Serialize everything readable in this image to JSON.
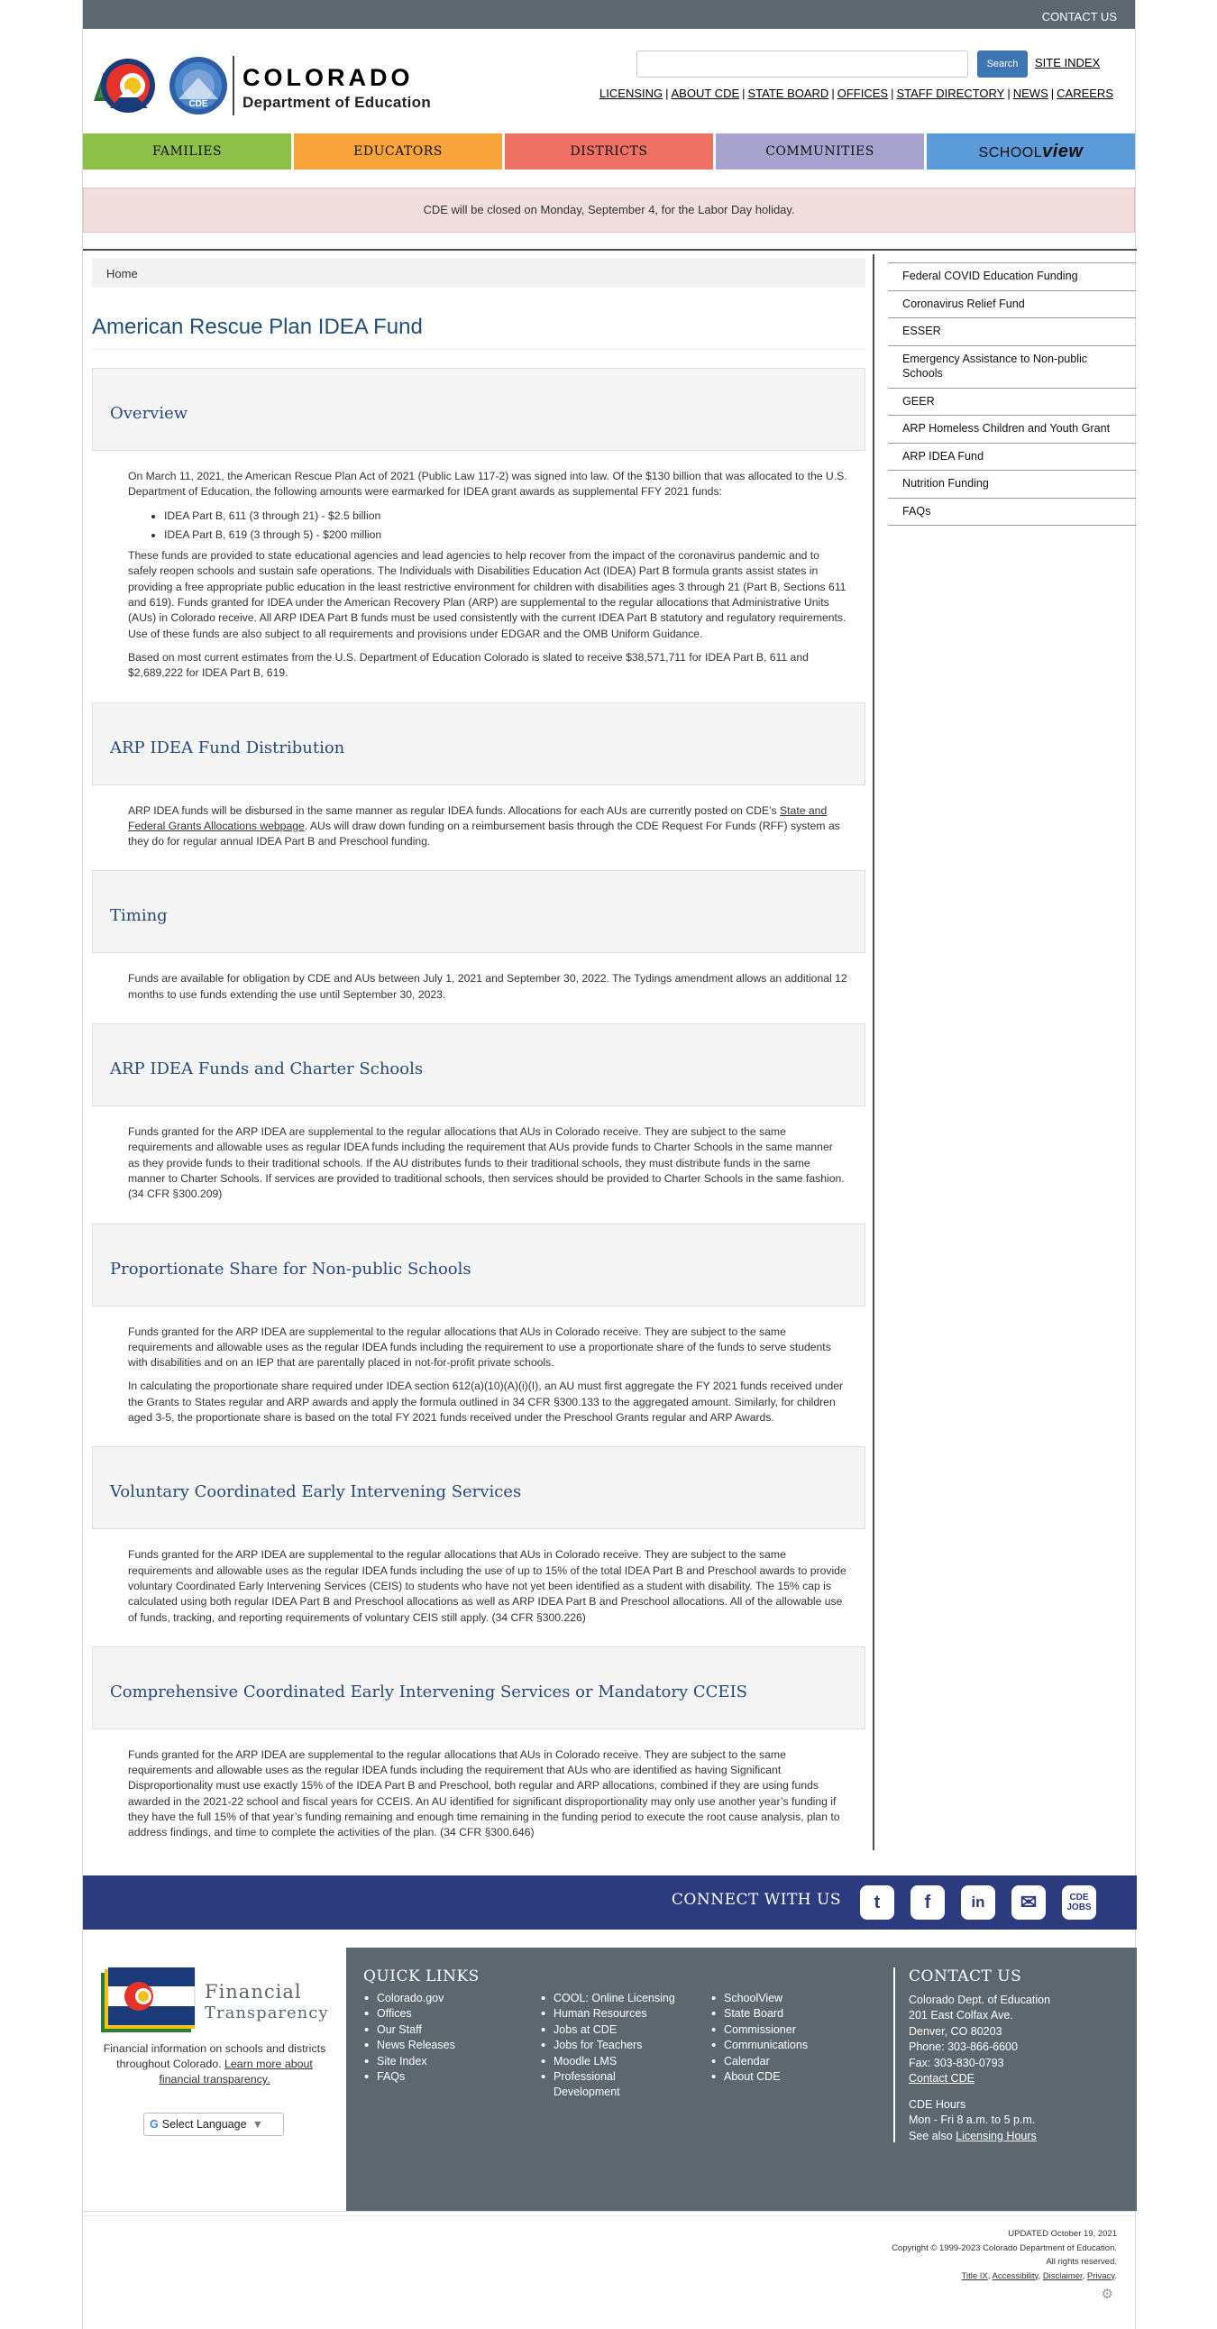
{
  "topbar": {
    "contact": "CONTACT US"
  },
  "header": {
    "title": "COLORADO",
    "subtitle": "Department of Education",
    "logo_badge": "CDE",
    "search_button": "Search",
    "site_index": "SITE INDEX",
    "utility_links": [
      "LICENSING",
      "ABOUT CDE",
      "STATE BOARD",
      "OFFICES",
      "STAFF DIRECTORY",
      "NEWS",
      "CAREERS"
    ]
  },
  "nav": {
    "families": "FAMILIES",
    "educators": "EDUCATORS",
    "districts": "DISTRICTS",
    "communities": "COMMUNITIES",
    "schoolview_a": "SCHOOL",
    "schoolview_b": "view"
  },
  "alert": "CDE will be closed on Monday, September 4, for the Labor Day holiday.",
  "breadcrumb": "Home",
  "page_title": "American Rescue Plan IDEA Fund",
  "sections": {
    "overview": {
      "title": "Overview",
      "p1": "On March 11, 2021, the American Rescue Plan Act of 2021 (Public Law 117-2) was signed into law. Of the $130 billion that was allocated to the U.S. Department of Education, the following amounts were earmarked for IDEA grant awards as supplemental FFY 2021 funds:",
      "li1": "IDEA Part B, 611 (3 through 21) - $2.5 billion",
      "li2": "IDEA Part B, 619 (3 through 5) - $200 million",
      "p2": "These funds are provided to state educational agencies and lead agencies to help recover from the impact of the coronavirus pandemic and to safely reopen schools and sustain safe operations. The Individuals with Disabilities Education Act (IDEA) Part B formula grants assist states in providing a free appropriate public education in the least restrictive environment for children with disabilities ages 3 through 21 (Part B, Sections 611 and 619). Funds granted for IDEA under the American Recovery Plan (ARP) are supplemental to the regular allocations that Administrative Units (AUs) in Colorado receive. All ARP IDEA Part B funds must be used consistently with the current IDEA Part B statutory and regulatory requirements. Use of these funds are also subject to all requirements and provisions under EDGAR and the OMB Uniform Guidance.",
      "p3": "Based on most current estimates from the U.S. Department of Education Colorado is slated to receive $38,571,711 for IDEA Part B, 611 and $2,689,222 for IDEA Part B, 619."
    },
    "distribution": {
      "title": "ARP IDEA Fund Distribution",
      "p1a": "ARP IDEA funds will be disbursed in the same manner as regular IDEA funds. Allocations for each AUs are currently posted on CDE’s ",
      "link": "State and Federal Grants Allocations webpage",
      "p1b": ". AUs will draw down funding on a reimbursement basis through the CDE Request For Funds (RFF) system as they do for regular annual IDEA Part B and Preschool funding."
    },
    "timing": {
      "title": "Timing",
      "p1": "Funds are available for obligation by CDE and AUs between July 1, 2021 and September 30, 2022. The Tydings amendment allows an additional 12 months to use funds extending the use until September 30, 2023."
    },
    "charter": {
      "title": "ARP IDEA Funds and Charter Schools",
      "p1": "Funds granted for the ARP IDEA are supplemental to the regular allocations that AUs in Colorado receive. They are subject to the same requirements and allowable uses as regular IDEA funds including the requirement that AUs provide funds to Charter Schools in the same manner as they provide funds to their traditional schools. If the AU distributes funds to their traditional schools, they must distribute funds in the same manner to Charter Schools. If services are provided to traditional schools, then services should be provided to Charter Schools in the same fashion. (34 CFR §300.209)"
    },
    "nonpublic": {
      "title": "Proportionate Share for Non-public Schools",
      "p1": "Funds granted for the ARP IDEA are supplemental to the regular allocations that AUs in Colorado receive. They are subject to the same requirements and allowable uses as the regular IDEA funds including the requirement to use a proportionate share of the funds to serve students with disabilities and on an IEP that are parentally placed in not-for-profit private schools.",
      "p2": "In calculating the proportionate share required under IDEA section 612(a)(10)(A)(i)(I), an AU must first aggregate the FY 2021 funds received under the Grants to States regular and ARP awards and apply the formula outlined in 34 CFR §300.133 to the aggregated amount. Similarly, for children aged 3-5, the proportionate share is based on the total FY 2021 funds received under the Preschool Grants regular and ARP Awards."
    },
    "ceis": {
      "title": "Voluntary Coordinated Early Intervening Services",
      "p1": "Funds granted for the ARP IDEA are supplemental to the regular allocations that AUs in Colorado receive. They are subject to the same requirements and allowable uses as the regular IDEA funds including the use of up to 15% of the total IDEA Part B and Preschool awards to provide voluntary Coordinated Early Intervening Services (CEIS) to students who have not yet been identified as a student with disability. The 15% cap is calculated using both regular IDEA Part B and Preschool allocations as well as ARP IDEA Part B and Preschool allocations. All of the allowable use of funds, tracking, and reporting requirements of voluntary CEIS still apply. (34 CFR §300.226)"
    },
    "cceis": {
      "title": "Comprehensive Coordinated Early Intervening Services or Mandatory CCEIS",
      "p1": "Funds granted for the ARP IDEA are supplemental to the regular allocations that AUs in Colorado receive. They are subject to the same requirements and allowable uses as the regular IDEA funds including the requirement that AUs who are identified as having Significant Disproportionality must use exactly 15% of the IDEA Part B and Preschool, both regular and ARP allocations, combined if they are using funds awarded in the 2021-22 school and fiscal years for CCEIS. An AU identified for significant disproportionality may only use another year’s funding if they have the full 15% of that year’s funding remaining and enough time remaining in the funding period to execute the root cause analysis, plan to address findings, and time to complete the activities of the plan. (34 CFR §300.646)"
    }
  },
  "sidebar": {
    "items": [
      "Federal COVID Education Funding",
      "Coronavirus Relief Fund",
      "ESSER",
      "Emergency Assistance to Non-public Schools",
      "GEER",
      "ARP Homeless Children and Youth Grant",
      "ARP IDEA Fund",
      "Nutrition Funding",
      "FAQs"
    ]
  },
  "connect": {
    "label": "CONNECT WITH US",
    "twitter": "t",
    "facebook": "f",
    "linkedin": "in",
    "email": "✉",
    "jobs_a": "CDE",
    "jobs_b": "JOBS"
  },
  "footer": {
    "ft_word1": "Financial",
    "ft_word2": "Transparency",
    "ft_text": "Financial information on schools and districts throughout Colorado. ",
    "ft_link": "Learn more about financial transparency.",
    "lang_g": "G",
    "lang": "Select Language",
    "lang_arrow": "▼",
    "quick_links_title": "QUICK LINKS",
    "col1": [
      "Colorado.gov",
      "Offices",
      "Our Staff",
      "News Releases",
      "Site Index",
      "FAQs"
    ],
    "col2": [
      "COOL: Online Licensing",
      "Human Resources",
      "Jobs at CDE",
      "Jobs for Teachers",
      "Moodle LMS",
      "Professional Development"
    ],
    "col3": [
      "SchoolView",
      "State Board",
      "Commissioner",
      "Communications",
      "Calendar",
      "About CDE"
    ],
    "contact_title": "CONTACT US",
    "contact": {
      "name": "Colorado Dept. of Education",
      "street": "201 East Colfax Ave.",
      "city": "Denver, CO 80203",
      "phone": "Phone: 303-866-6600",
      "fax": "Fax: 303-830-0793",
      "link": "Contact CDE"
    },
    "hours_title": "CDE Hours",
    "hours": "Mon - Fri 8 a.m. to 5 p.m.",
    "see_also": "See also ",
    "licensing_hours": "Licensing Hours"
  },
  "bottom": {
    "updated": "UPDATED October 19, 2021",
    "copyright": "Copyright © 1999-2023 Colorado Department of Education.",
    "rights": "All rights reserved.",
    "links": [
      "Title IX",
      "Accessibility",
      "Disclaimer",
      "Privacy"
    ]
  }
}
